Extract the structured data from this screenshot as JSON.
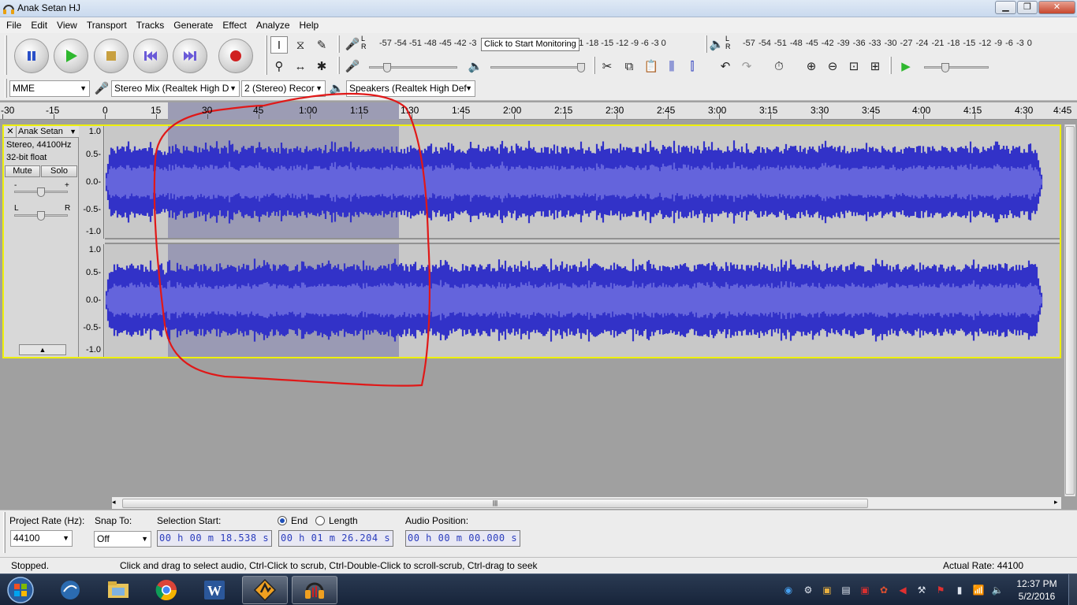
{
  "window": {
    "title": "Anak Setan HJ",
    "min_icon": "minimize-icon",
    "max_icon": "maximize-icon",
    "close_icon": "close-icon"
  },
  "menu": [
    "File",
    "Edit",
    "View",
    "Transport",
    "Tracks",
    "Generate",
    "Effect",
    "Analyze",
    "Help"
  ],
  "transport": {
    "icons": [
      "pause-icon",
      "play-icon",
      "stop-icon",
      "skip-to-start-icon",
      "skip-to-end-icon",
      "record-icon"
    ]
  },
  "meters": {
    "record_scale": "-57 -54 -51 -48 -45 -42 -3",
    "record_scale_tail": "21 -18 -15 -12 -9 -6 -3 0",
    "monitor_tooltip": "Click to Start Monitoring",
    "playback_scale": "-57 -54 -51 -48 -45 -42 -39 -36 -33 -30 -27 -24 -21 -18 -15 -12 -9 -6 -3 0",
    "channel_L": "L",
    "channel_R": "R"
  },
  "devices": {
    "host": "MME",
    "input": "Stereo Mix (Realtek High D",
    "channels": "2 (Stereo) Recor",
    "output": "Speakers (Realtek High Def"
  },
  "ruler": {
    "labels": [
      "-30",
      "-15",
      "0",
      "15",
      "30",
      "45",
      "1:00",
      "1:15",
      "1:30",
      "1:45",
      "2:00",
      "2:15",
      "2:30",
      "2:45",
      "3:00",
      "3:15",
      "3:30",
      "3:45",
      "4:00",
      "4:15",
      "4:30",
      "4:45"
    ],
    "selection_start_s": 18.538,
    "selection_end_s": 86.204
  },
  "track": {
    "close_label": "✕",
    "name": "Anak Setan",
    "info1": "Stereo, 44100Hz",
    "info2": "32-bit float",
    "mute": "Mute",
    "solo": "Solo",
    "gain_minus": "-",
    "gain_plus": "+",
    "pan_left": "L",
    "pan_right": "R",
    "scale": [
      "1.0",
      "0.5-",
      "0.0-",
      "-0.5-",
      "-1.0"
    ]
  },
  "selection_bar": {
    "project_rate_label": "Project Rate (Hz):",
    "project_rate": "44100",
    "snap_label": "Snap To:",
    "snap_value": "Off",
    "selection_start_label": "Selection Start:",
    "end_label": "End",
    "length_label": "Length",
    "audio_position_label": "Audio Position:",
    "selection_start": "00 h 00 m 18.538 s",
    "selection_end": "00 h 01 m 26.204 s",
    "audio_position": "00 h 00 m 00.000 s"
  },
  "status": {
    "state": "Stopped.",
    "hint": "Click and drag to select audio, Ctrl-Click to scrub, Ctrl-Double-Click to scroll-scrub, Ctrl-drag to seek",
    "actual_rate": "Actual Rate: 44100"
  },
  "taskbar": {
    "apps": [
      "windows-start-icon",
      "browser-icon",
      "file-explorer-icon",
      "chrome-icon",
      "word-icon",
      "winamp-icon",
      "audacity-icon"
    ],
    "time": "12:37 PM",
    "date": "5/2/2016"
  },
  "colors": {
    "waveform": "#3232c8",
    "waveform_rms": "#6464dc",
    "selection": "#9c9cb4",
    "annotation": "#e01818",
    "track_focus": "#eef00a"
  }
}
